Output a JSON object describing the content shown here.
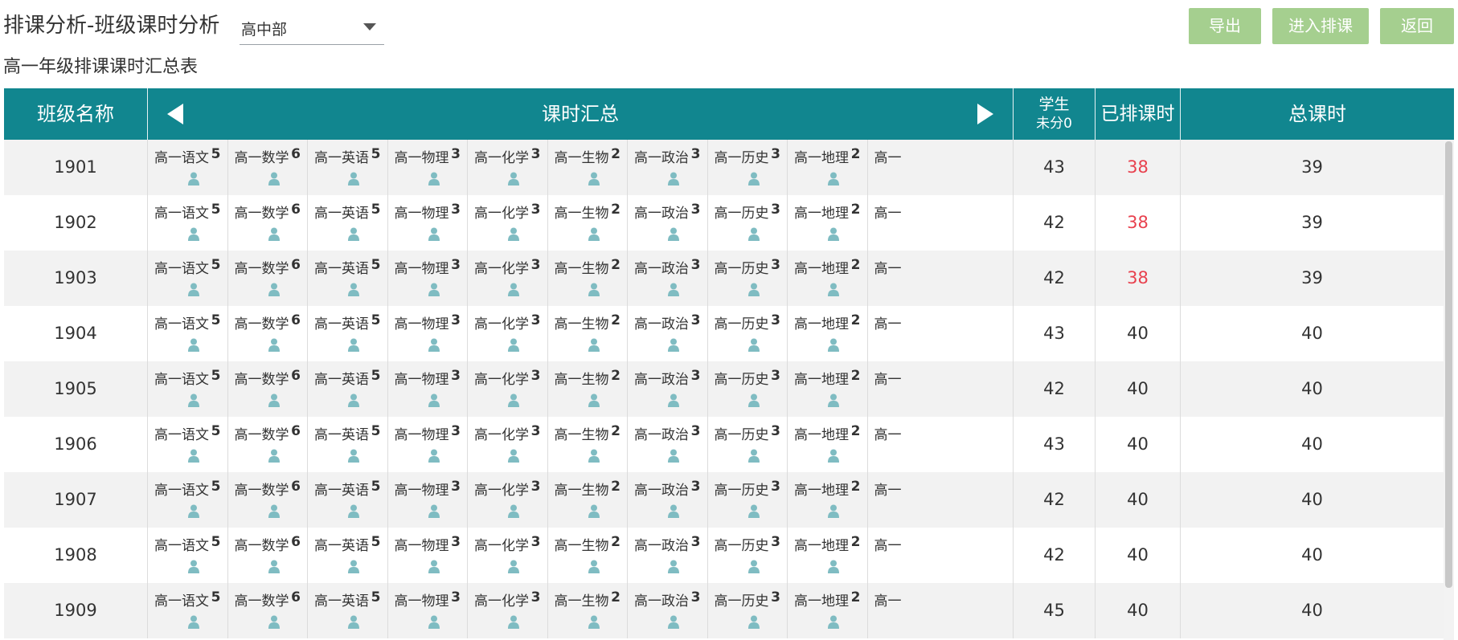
{
  "header": {
    "title": "排课分析-班级课时分析",
    "department_select": {
      "value": "高中部"
    },
    "subtitle": "高一年级排课课时汇总表",
    "buttons": {
      "export": "导出",
      "enter_schedule": "进入排课",
      "back": "返回"
    },
    "colors": {
      "button_bg": "#a5cf8f",
      "header_bg": "#11868f",
      "highlight_red": "#e8414e"
    }
  },
  "table": {
    "columns": {
      "class_name": "班级名称",
      "hours_summary": "课时汇总",
      "students_line1": "学生",
      "students_line2": "未分0",
      "scheduled_hours": "已排课时",
      "total_hours": "总课时"
    },
    "subjects": [
      {
        "name": "高一语文",
        "hours": "5"
      },
      {
        "name": "高一数学",
        "hours": "6"
      },
      {
        "name": "高一英语",
        "hours": "5"
      },
      {
        "name": "高一物理",
        "hours": "3"
      },
      {
        "name": "高一化学",
        "hours": "3"
      },
      {
        "name": "高一生物",
        "hours": "2"
      },
      {
        "name": "高一政治",
        "hours": "3"
      },
      {
        "name": "高一历史",
        "hours": "3"
      },
      {
        "name": "高一地理",
        "hours": "2"
      },
      {
        "name": "高一",
        "hours": ""
      }
    ],
    "subject_icon": "person-icon",
    "rows": [
      {
        "class": "1901",
        "students": "43",
        "scheduled": "38",
        "total": "39",
        "scheduled_highlight": true
      },
      {
        "class": "1902",
        "students": "42",
        "scheduled": "38",
        "total": "39",
        "scheduled_highlight": true
      },
      {
        "class": "1903",
        "students": "42",
        "scheduled": "38",
        "total": "39",
        "scheduled_highlight": true
      },
      {
        "class": "1904",
        "students": "43",
        "scheduled": "40",
        "total": "40",
        "scheduled_highlight": false
      },
      {
        "class": "1905",
        "students": "42",
        "scheduled": "40",
        "total": "40",
        "scheduled_highlight": false
      },
      {
        "class": "1906",
        "students": "43",
        "scheduled": "40",
        "total": "40",
        "scheduled_highlight": false
      },
      {
        "class": "1907",
        "students": "42",
        "scheduled": "40",
        "total": "40",
        "scheduled_highlight": false
      },
      {
        "class": "1908",
        "students": "42",
        "scheduled": "40",
        "total": "40",
        "scheduled_highlight": false
      },
      {
        "class": "1909",
        "students": "45",
        "scheduled": "40",
        "total": "40",
        "scheduled_highlight": false
      }
    ]
  }
}
